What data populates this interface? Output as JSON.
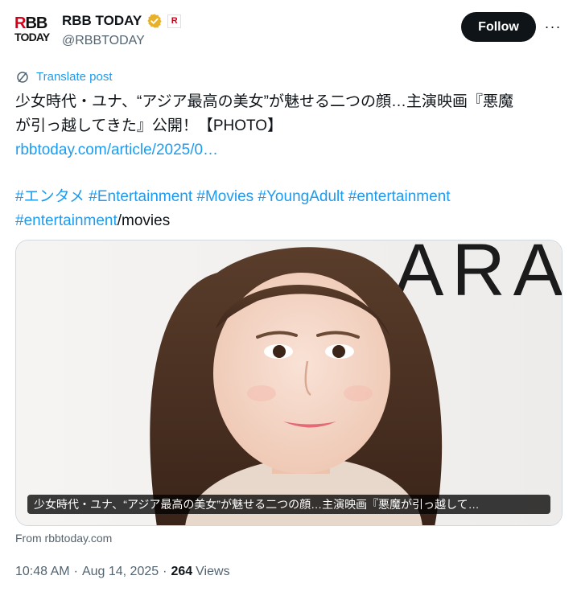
{
  "account": {
    "logo_line1_red": "R",
    "logo_line1_rest": "BB",
    "logo_line2": "TODAY",
    "name": "RBB TODAY",
    "handle": "@RBBTODAY",
    "verified_icon": "gold-verified-badge-icon",
    "affiliate_icon": "affiliate-logo-icon",
    "affiliate_mark": "R"
  },
  "actions": {
    "follow_label": "Follow",
    "more_label": "···"
  },
  "translate": {
    "label": "Translate post",
    "icon": "translate-icon"
  },
  "post": {
    "line1": "少女時代・ユナ、“アジア最高の美女”が魅せる二つの顔…主演映画『悪魔",
    "line2": "が引っ越してきた』公開！【PHOTO】",
    "link": "rbbtoday.com/article/2025/0…",
    "hashtags_line1": "#エンタメ #Entertainment #Movies #YoungAdult #entertainment",
    "hashtag_line2": "#entertainment",
    "hashtag_line2_suffix": "/movies"
  },
  "card": {
    "caption": "少女時代・ユナ、“アジア最高の美女”が魅せる二つの顔…主演映画『悪魔が引っ越して…",
    "photo_backdrop_text": "ARA",
    "source": "From rbbtoday.com"
  },
  "meta": {
    "time": "10:48 AM",
    "separator": "·",
    "date": "Aug 14, 2025",
    "views_count": "264",
    "views_label": "Views"
  },
  "colors": {
    "link": "#1d9bf0",
    "text": "#0f1419",
    "muted": "#536471",
    "follow_bg": "#0f1419",
    "brand_red": "#d0021b",
    "verified_gold": "#e8b12b"
  }
}
